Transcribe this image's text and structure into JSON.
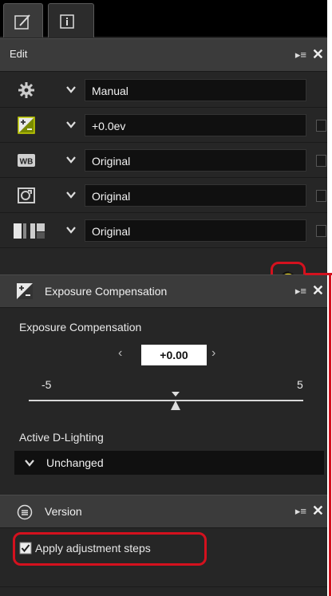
{
  "tabs": [
    {
      "name": "edit-tab",
      "icon": "edit-icon"
    },
    {
      "name": "info-tab",
      "icon": "info-icon"
    }
  ],
  "edit_palette": {
    "title": "Edit",
    "menu_glyph": "▸≡",
    "close_glyph": "✕",
    "rows": [
      {
        "icon": "gear-icon",
        "value": "Manual"
      },
      {
        "icon": "exposure-compensation-icon",
        "value": "+0.0ev"
      },
      {
        "icon": "white-balance-icon",
        "icon_text": "WB",
        "value": "Original"
      },
      {
        "icon": "picture-control-icon",
        "value": "Original"
      },
      {
        "icon": "tone-curve-icon",
        "value": "Original"
      }
    ],
    "tools": [
      "noise-reduction-icon",
      "perspective-icon",
      "levels-curves-icon",
      "color-booster-icon",
      "straighten-icon",
      "color-adjust-icon",
      "retouch-brush-icon"
    ]
  },
  "exposure": {
    "title": "Exposure Compensation",
    "label": "Exposure Compensation",
    "value": "+0.00",
    "min_label": "-5",
    "max_label": "5",
    "left_arrow": "‹",
    "right_arrow": "›",
    "active_d_lighting_label": "Active D-Lighting",
    "active_d_lighting_value": "Unchanged"
  },
  "version": {
    "title": "Version",
    "apply_label": "Apply adjustment steps",
    "apply_checked": true
  },
  "colors": {
    "accent_red": "#d4111e",
    "version_icon_yellow": "#e6d21f"
  }
}
